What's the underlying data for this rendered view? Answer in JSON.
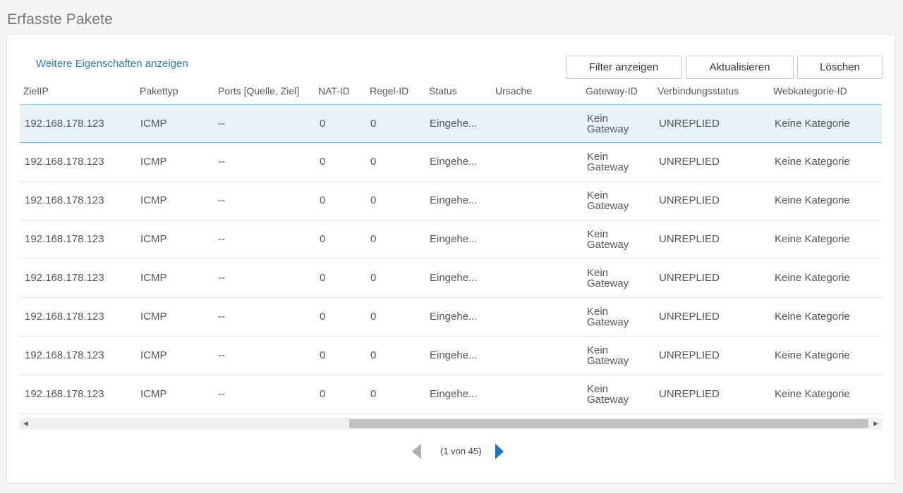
{
  "page": {
    "title": "Erfasste Pakete"
  },
  "toolbar": {
    "more_link": "Weitere Eigenschaften anzeigen",
    "filter_label": "Filter anzeigen",
    "refresh_label": "Aktualisieren",
    "delete_label": "Löschen"
  },
  "table": {
    "columns": [
      "ZielIP",
      "Pakettyp",
      "Ports [Quelle, Ziel]",
      "NAT-ID",
      "Regel-ID",
      "Status",
      "Ursache",
      "Gateway-ID",
      "Verbindungsstatus",
      "Webkategorie-ID"
    ],
    "rows": [
      {
        "ip": "192.168.178.123",
        "type": "ICMP",
        "ports": "--",
        "nat": "0",
        "rule": "0",
        "status": "Eingehe...",
        "reason": "",
        "gw1": "Kein",
        "gw2": "Gateway",
        "conn": "UNREPLIED",
        "web": "Keine Kategorie"
      },
      {
        "ip": "192.168.178.123",
        "type": "ICMP",
        "ports": "--",
        "nat": "0",
        "rule": "0",
        "status": "Eingehe...",
        "reason": "",
        "gw1": "Kein",
        "gw2": "Gateway",
        "conn": "UNREPLIED",
        "web": "Keine Kategorie"
      },
      {
        "ip": "192.168.178.123",
        "type": "ICMP",
        "ports": "--",
        "nat": "0",
        "rule": "0",
        "status": "Eingehe...",
        "reason": "",
        "gw1": "Kein",
        "gw2": "Gateway",
        "conn": "UNREPLIED",
        "web": "Keine Kategorie"
      },
      {
        "ip": "192.168.178.123",
        "type": "ICMP",
        "ports": "--",
        "nat": "0",
        "rule": "0",
        "status": "Eingehe...",
        "reason": "",
        "gw1": "Kein",
        "gw2": "Gateway",
        "conn": "UNREPLIED",
        "web": "Keine Kategorie"
      },
      {
        "ip": "192.168.178.123",
        "type": "ICMP",
        "ports": "--",
        "nat": "0",
        "rule": "0",
        "status": "Eingehe...",
        "reason": "",
        "gw1": "Kein",
        "gw2": "Gateway",
        "conn": "UNREPLIED",
        "web": "Keine Kategorie"
      },
      {
        "ip": "192.168.178.123",
        "type": "ICMP",
        "ports": "--",
        "nat": "0",
        "rule": "0",
        "status": "Eingehe...",
        "reason": "",
        "gw1": "Kein",
        "gw2": "Gateway",
        "conn": "UNREPLIED",
        "web": "Keine Kategorie"
      },
      {
        "ip": "192.168.178.123",
        "type": "ICMP",
        "ports": "--",
        "nat": "0",
        "rule": "0",
        "status": "Eingehe...",
        "reason": "",
        "gw1": "Kein",
        "gw2": "Gateway",
        "conn": "UNREPLIED",
        "web": "Keine Kategorie"
      },
      {
        "ip": "192.168.178.123",
        "type": "ICMP",
        "ports": "--",
        "nat": "0",
        "rule": "0",
        "status": "Eingehe...",
        "reason": "",
        "gw1": "Kein",
        "gw2": "Gateway",
        "conn": "UNREPLIED",
        "web": "Keine Kategorie"
      }
    ],
    "selected_row": 0
  },
  "pagination": {
    "info": "(1 von 45)"
  },
  "icons": {
    "prev": "triangle-left-icon",
    "next": "triangle-right-icon",
    "scroll_left": "scroll-left-icon",
    "scroll_right": "scroll-right-icon"
  },
  "colors": {
    "accent": "#1a73c9",
    "link": "#2a7ab7",
    "selected_row": "#e6f1f8"
  }
}
